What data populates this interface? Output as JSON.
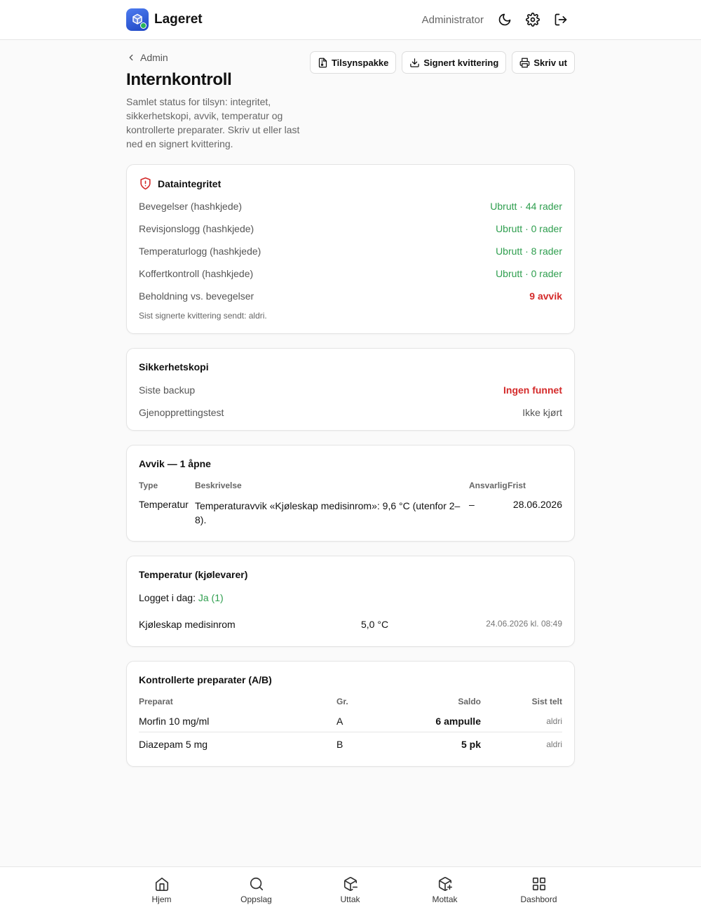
{
  "app": {
    "name": "Lageret",
    "role": "Administrator"
  },
  "page": {
    "back_label": "Admin",
    "title": "Internkontroll",
    "description": "Samlet status for tilsyn: integritet, sikkerhetskopi, avvik, temperatur og kontrollerte preparater. Skriv ut eller last ned en signert kvittering.",
    "actions": {
      "package": "Tilsynspakke",
      "receipt": "Signert kvittering",
      "print": "Skriv ut"
    }
  },
  "integrity": {
    "title": "Dataintegritet",
    "rows": [
      {
        "label": "Bevegelser (hashkjede)",
        "value": "Ubrutt · 44 rader",
        "status": "ok"
      },
      {
        "label": "Revisjonslogg (hashkjede)",
        "value": "Ubrutt · 0 rader",
        "status": "ok"
      },
      {
        "label": "Temperaturlogg (hashkjede)",
        "value": "Ubrutt · 8 rader",
        "status": "ok"
      },
      {
        "label": "Koffertkontroll (hashkjede)",
        "value": "Ubrutt · 0 rader",
        "status": "ok"
      },
      {
        "label": "Beholdning vs. bevegelser",
        "value": "9 avvik",
        "status": "bad"
      }
    ],
    "note": "Sist signerte kvittering sendt: aldri."
  },
  "backup": {
    "title": "Sikkerhetskopi",
    "rows": [
      {
        "label": "Siste backup",
        "value": "Ingen funnet",
        "status": "bad"
      },
      {
        "label": "Gjenopprettingstest",
        "value": "Ikke kjørt",
        "status": "muted"
      }
    ]
  },
  "deviations": {
    "title": "Avvik — 1 åpne",
    "headers": {
      "type": "Type",
      "description": "Beskrivelse",
      "responsible": "Ansvarlig",
      "deadline": "Frist"
    },
    "rows": [
      {
        "type": "Temperatur",
        "description": "Temperaturavvik «Kjøleskap medisinrom»: 9,6 °C (utenfor 2–8).",
        "responsible": "–",
        "deadline": "28.06.2026"
      }
    ]
  },
  "temperature": {
    "title": "Temperatur (kjølevarer)",
    "logged_label": "Logget i dag:",
    "logged_value": "Ja (1)",
    "rows": [
      {
        "unit": "Kjøleskap medisinrom",
        "value": "5,0 °C",
        "time": "24.06.2026 kl. 08:49"
      }
    ]
  },
  "controlled": {
    "title": "Kontrollerte preparater (A/B)",
    "headers": {
      "drug": "Preparat",
      "group": "Gr.",
      "balance": "Saldo",
      "counted": "Sist telt"
    },
    "rows": [
      {
        "drug": "Morfin 10 mg/ml",
        "group": "A",
        "balance": "6 ampulle",
        "counted": "aldri"
      },
      {
        "drug": "Diazepam 5 mg",
        "group": "B",
        "balance": "5 pk",
        "counted": "aldri"
      }
    ]
  },
  "nav": {
    "home": "Hjem",
    "lookup": "Oppslag",
    "withdraw": "Uttak",
    "receive": "Mottak",
    "dashboard": "Dashbord"
  },
  "colors": {
    "accent": "#2f5fe0",
    "ok": "#2e9e4e",
    "bad": "#d42a2a"
  }
}
